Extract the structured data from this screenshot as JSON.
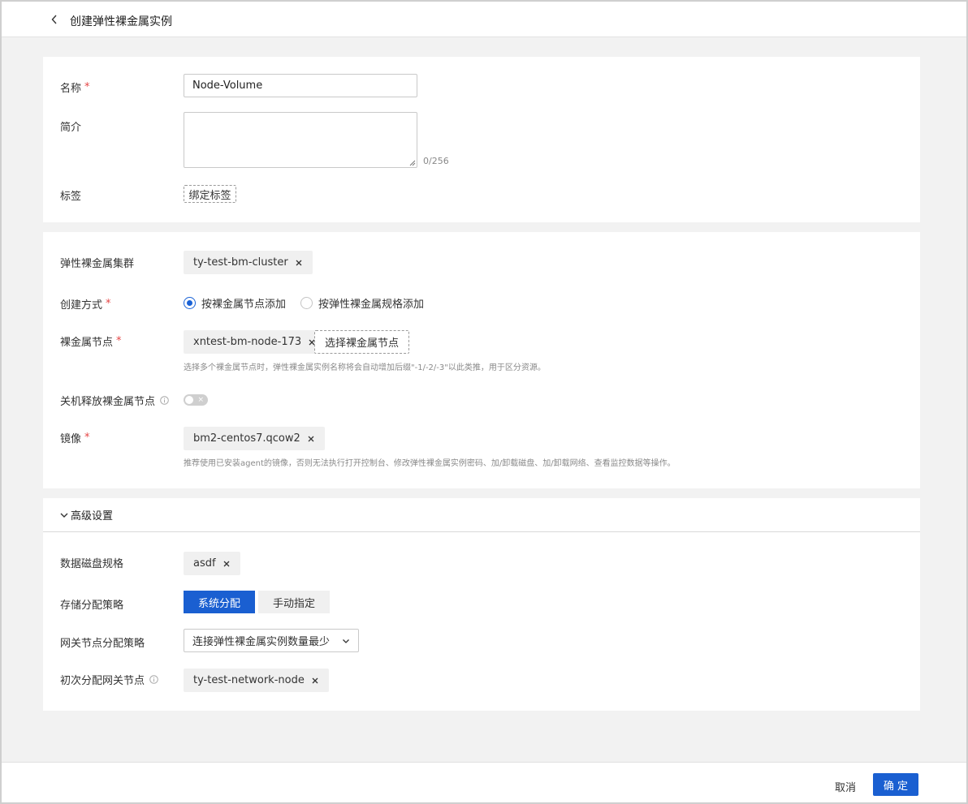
{
  "header": {
    "title": "创建弹性裸金属实例"
  },
  "basic": {
    "name_label": "名称",
    "name_value": "Node-Volume",
    "desc_label": "简介",
    "desc_value": "",
    "desc_counter": "0/256",
    "tag_label": "标签",
    "tag_button": "绑定标签"
  },
  "config": {
    "cluster_label": "弹性裸金属集群",
    "cluster_value": "ty-test-bm-cluster",
    "method_label": "创建方式",
    "method_options": [
      "按裸金属节点添加",
      "按弹性裸金属规格添加"
    ],
    "method_selected": "按裸金属节点添加",
    "node_label": "裸金属节点",
    "node_value": "xntest-bm-node-173",
    "node_select_button": "选择裸金属节点",
    "node_hint": "选择多个裸金属节点时，弹性裸金属实例名称将会自动增加后缀\"-1/-2/-3\"以此类推，用于区分资源。",
    "release_label": "关机释放裸金属节点",
    "release_enabled": false,
    "image_label": "镜像",
    "image_value": "bm2-centos7.qcow2",
    "image_hint": "推荐使用已安装agent的镜像，否则无法执行打开控制台、修改弹性裸金属实例密码、加/卸载磁盘、加/卸载网络、查看监控数据等操作。"
  },
  "advanced": {
    "title": "高级设置",
    "disk_label": "数据磁盘规格",
    "disk_value": "asdf",
    "storage_label": "存储分配策略",
    "storage_options": [
      "系统分配",
      "手动指定"
    ],
    "storage_selected": "系统分配",
    "gateway_policy_label": "网关节点分配策略",
    "gateway_policy_value": "连接弹性裸金属实例数量最少",
    "gateway_node_label": "初次分配网关节点",
    "gateway_node_value": "ty-test-network-node"
  },
  "footer": {
    "cancel": "取消",
    "confirm": "确 定"
  },
  "colors": {
    "primary": "#1a5fd1",
    "required": "#e54545"
  }
}
